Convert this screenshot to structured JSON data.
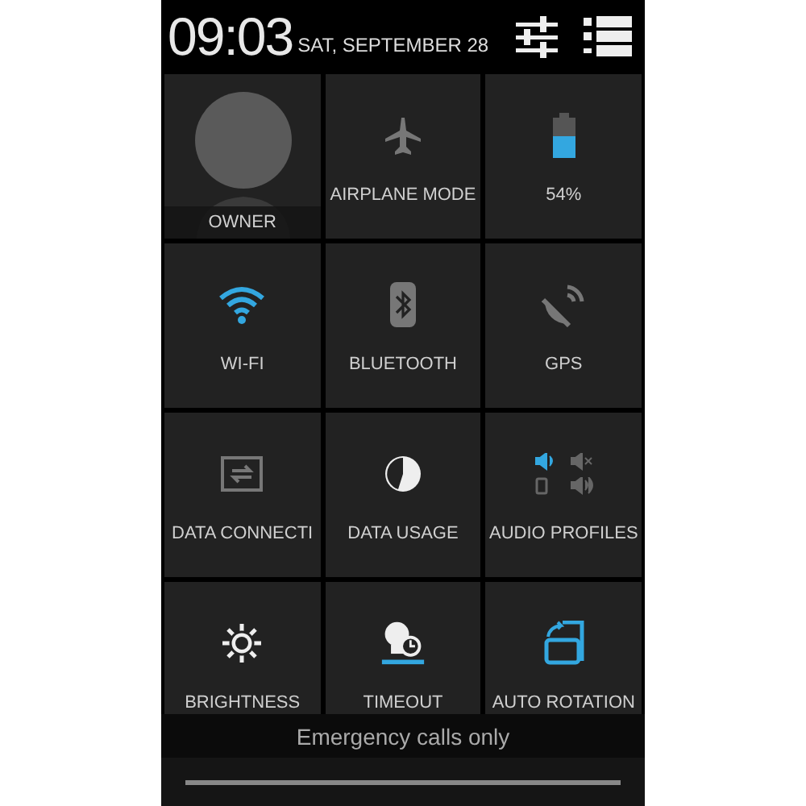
{
  "header": {
    "time": "09:03",
    "date": "SAT, SEPTEMBER 28"
  },
  "user": {
    "label": "OWNER"
  },
  "tiles": [
    {
      "kind": "airplane",
      "label": "AIRPLANE MODE",
      "on": false
    },
    {
      "kind": "battery",
      "label": "54%",
      "level": 0.54
    },
    {
      "kind": "wifi",
      "label": "WI-FI",
      "on": true
    },
    {
      "kind": "bluetooth",
      "label": "BLUETOOTH",
      "on": false
    },
    {
      "kind": "gps",
      "label": "GPS",
      "on": false
    },
    {
      "kind": "data-connection",
      "label": "DATA CONNECTI",
      "on": false
    },
    {
      "kind": "data-usage",
      "label": "DATA USAGE"
    },
    {
      "kind": "audio-profiles",
      "label": "AUDIO PROFILES",
      "profiles": [
        {
          "selected": true
        },
        {
          "selected": false
        },
        {
          "selected": false
        },
        {
          "selected": false
        }
      ]
    },
    {
      "kind": "brightness",
      "label": "BRIGHTNESS"
    },
    {
      "kind": "timeout",
      "label": "TIMEOUT"
    },
    {
      "kind": "rotation",
      "label": "AUTO ROTATION",
      "on": true
    }
  ],
  "status": "Emergency calls only"
}
